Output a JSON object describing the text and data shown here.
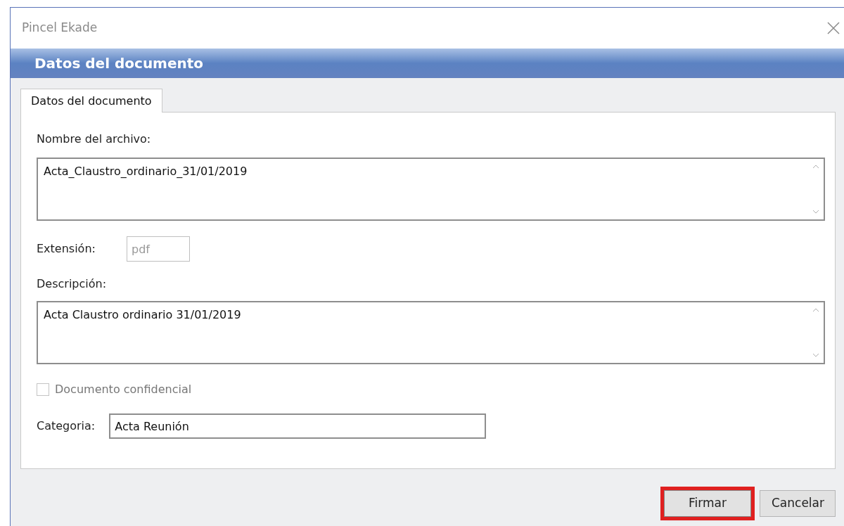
{
  "window": {
    "title": "Pincel Ekade"
  },
  "header": {
    "title": "Datos del documento"
  },
  "tabs": [
    {
      "label": "Datos del documento",
      "selected": true
    }
  ],
  "form": {
    "file_name": {
      "label": "Nombre del archivo:",
      "value": "Acta_Claustro_ordinario_31/01/2019"
    },
    "extension": {
      "label": "Extensión:",
      "value": "pdf",
      "disabled": true
    },
    "description": {
      "label": "Descripción:",
      "value": "Acta Claustro ordinario 31/01/2019"
    },
    "confidential": {
      "label": "Documento confidencial",
      "checked": false,
      "disabled": true
    },
    "category": {
      "label": "Categoria:",
      "value": "Acta Reunión"
    }
  },
  "buttons": [
    {
      "label": "Firmar",
      "highlighted": true
    },
    {
      "label": "Cancelar",
      "highlighted": false
    }
  ]
}
